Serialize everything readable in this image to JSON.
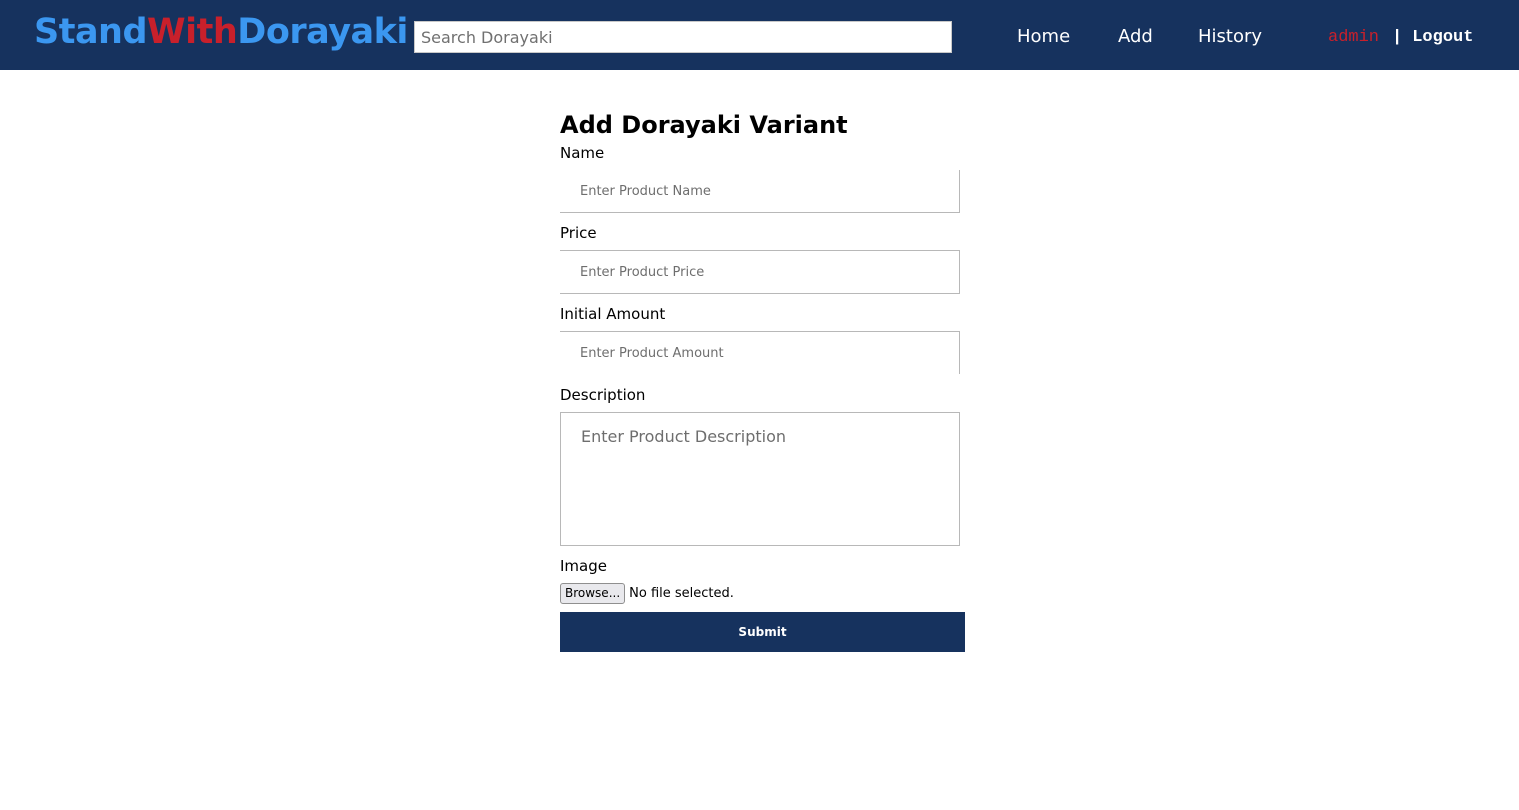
{
  "header": {
    "brand": {
      "part1": "Stand",
      "part2": "With",
      "part3": "Dorayaki"
    },
    "search": {
      "placeholder": "Search Dorayaki",
      "value": ""
    },
    "nav": {
      "home": "Home",
      "add": "Add",
      "history": "History"
    },
    "user": {
      "name": "admin",
      "separator": "|",
      "logout": "Logout"
    }
  },
  "form": {
    "title": "Add Dorayaki Variant",
    "name": {
      "label": "Name",
      "placeholder": "Enter Product Name"
    },
    "price": {
      "label": "Price",
      "placeholder": "Enter Product Price"
    },
    "amount": {
      "label": "Initial Amount",
      "placeholder": "Enter Product Amount"
    },
    "description": {
      "label": "Description",
      "placeholder": "Enter Product Description"
    },
    "image": {
      "label": "Image",
      "browse_label": "Browse...",
      "status": "No file selected."
    },
    "submit_label": "Submit"
  },
  "colors": {
    "navbar": "#16325e",
    "brand_blue": "#3b97f0",
    "brand_red": "#c8202b",
    "submit_bg": "#16325e"
  }
}
